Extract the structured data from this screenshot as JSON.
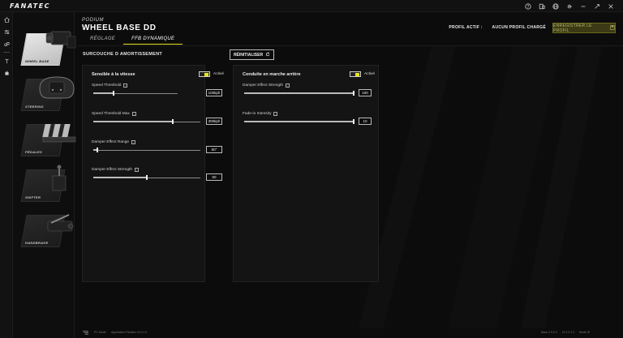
{
  "app": {
    "logo": "FANATEC"
  },
  "topbar_icons": [
    "help-icon",
    "device-icon",
    "globe-icon",
    "settings-icon",
    "minimize-icon",
    "maximize-icon",
    "close-icon"
  ],
  "rail_icons": [
    "home-icon",
    "tuning-icon",
    "wheel-settings-icon",
    "firmware-icon",
    "plugin-icon"
  ],
  "devices": [
    {
      "label": "WHEEL BASE",
      "active": true
    },
    {
      "label": "STEERING",
      "active": false
    },
    {
      "label": "PÉDALES",
      "active": false
    },
    {
      "label": "SHIFTER",
      "active": false
    },
    {
      "label": "HANDBRAKE",
      "active": false
    }
  ],
  "header": {
    "brand": "PODIUM",
    "title": "WHEEL BASE DD",
    "tabs": [
      {
        "label": "RÉGLAGE",
        "active": false
      },
      {
        "label": "FFB DYNAMIQUE",
        "active": true
      }
    ],
    "profile_label": "PROFIL ACTIF :",
    "profile_value": "AUCUN PROFIL CHARGÉ",
    "save_button": "ENREGISTRER LE PROFIL"
  },
  "section": {
    "title": "SURCOUCHE D AMORTISSEMENT",
    "reset_button": "RÉINITIALISER"
  },
  "panels": {
    "left": {
      "title": "Sensible à la vitesse",
      "toggle_label": "Activé",
      "fields": [
        {
          "label": "Speed Threshold",
          "value": "100kph",
          "level": 0.24
        },
        {
          "label": "Speed Threshold Max",
          "value": "300kph",
          "level": 0.74
        },
        {
          "label": "Damper Effect Range",
          "value": "50°",
          "level": 0.04
        },
        {
          "label": "Damper Effect Strength",
          "value": "50",
          "level": 0.5
        }
      ]
    },
    "right": {
      "title": "Conduite en marche arrière",
      "toggle_label": "Activé",
      "fields": [
        {
          "label": "Damper Effect Strength",
          "value": "100",
          "level": 1.0
        },
        {
          "label": "Fade-in Intensity",
          "value": "10",
          "level": 1.0
        }
      ]
    }
  },
  "footer": {
    "device_label": "PC Mode",
    "app_version": "Application Fanatec v1.0.1.2",
    "base_version": "Base 2.9.0.0",
    "ui_version": "UI 1.0.1.2",
    "mode": "Mode W"
  },
  "colors": {
    "accent": "#e7e31b",
    "background": "#0c0c0c",
    "panel": "#141414"
  }
}
